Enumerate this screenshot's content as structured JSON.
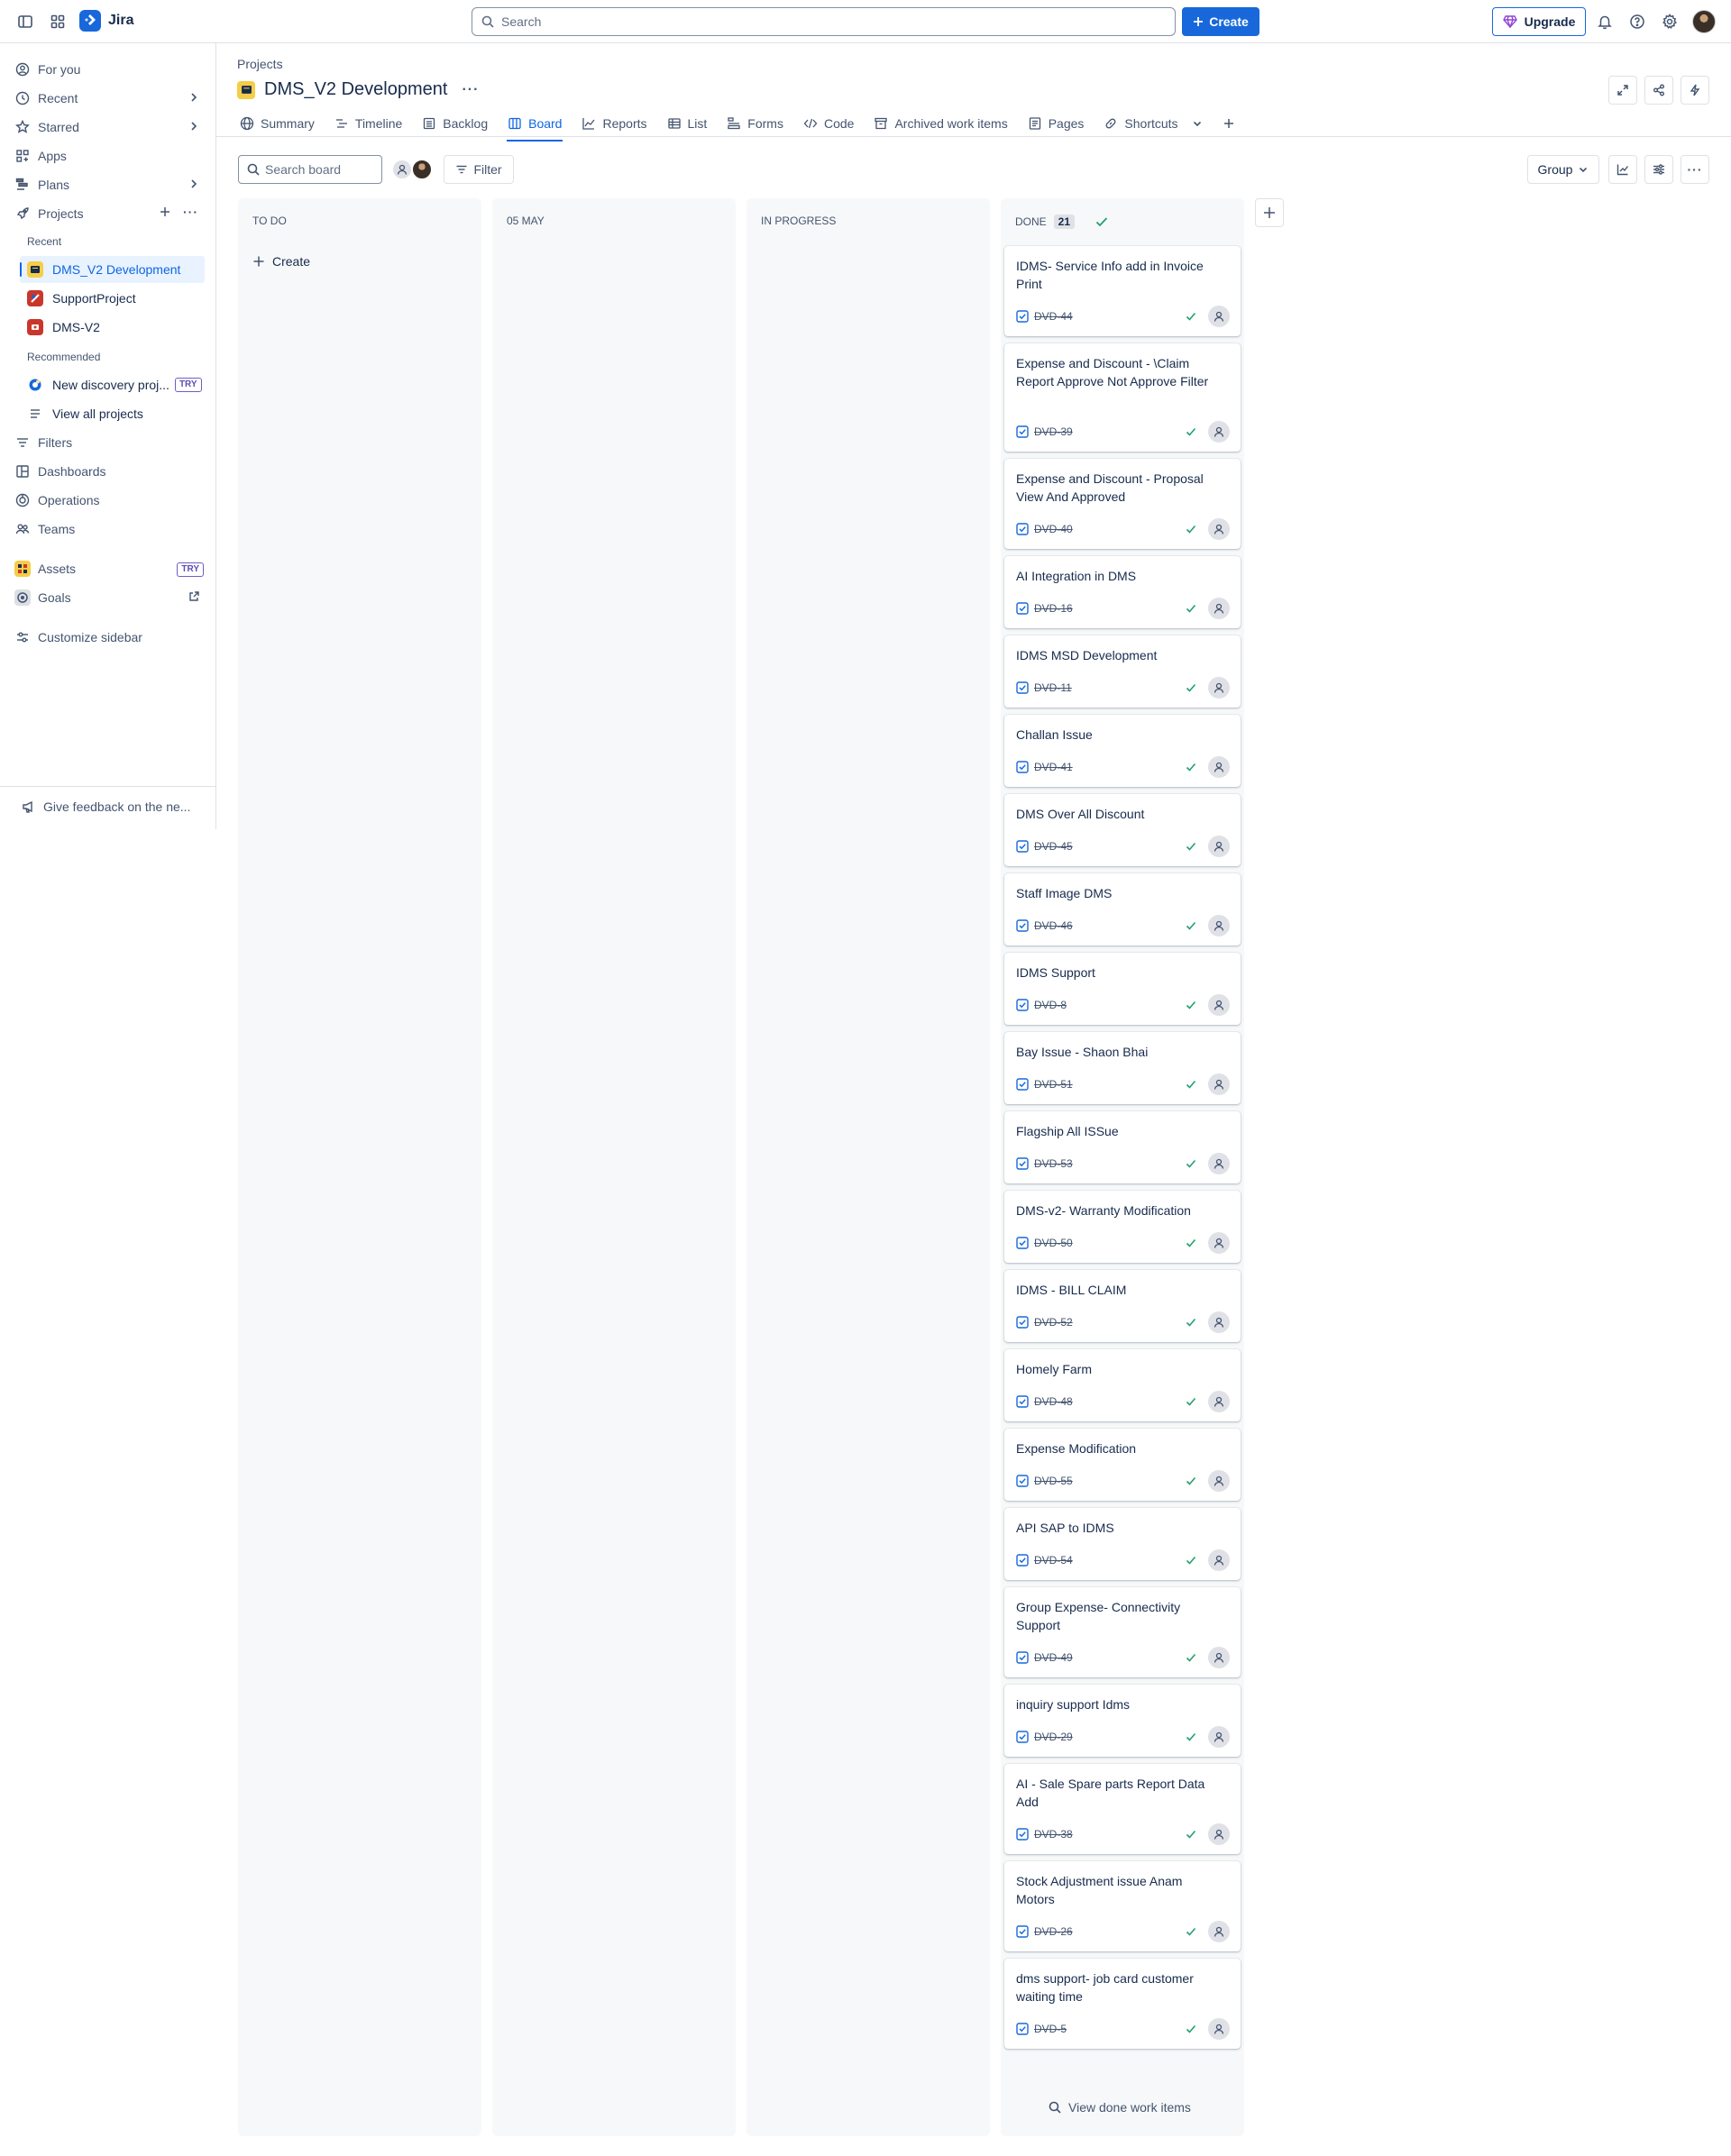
{
  "app": {
    "name": "Jira"
  },
  "topbar": {
    "search_placeholder": "Search",
    "create_label": "Create",
    "upgrade_label": "Upgrade"
  },
  "sidebar": {
    "nav": {
      "for_you": "For you",
      "recent": "Recent",
      "starred": "Starred",
      "apps": "Apps",
      "plans": "Plans",
      "projects": "Projects"
    },
    "recent_heading": "Recent",
    "recent_projects": [
      {
        "name": "DMS_V2 Development",
        "color": "#f5cd47"
      },
      {
        "name": "SupportProject",
        "color": "#c9372c"
      },
      {
        "name": "DMS-V2",
        "color": "#c9372c"
      }
    ],
    "recommended_heading": "Recommended",
    "new_discovery": "New discovery proj...",
    "try_badge": "TRY",
    "view_all_projects": "View all projects",
    "lower_nav": {
      "filters": "Filters",
      "dashboards": "Dashboards",
      "operations": "Operations",
      "teams": "Teams",
      "assets": "Assets",
      "goals": "Goals"
    },
    "customize": "Customize sidebar",
    "feedback": "Give feedback on the ne..."
  },
  "header": {
    "breadcrumb": "Projects",
    "project_title": "DMS_V2 Development",
    "more": "···"
  },
  "tabs": [
    {
      "label": "Summary",
      "icon": "globe-icon"
    },
    {
      "label": "Timeline",
      "icon": "timeline-icon"
    },
    {
      "label": "Backlog",
      "icon": "backlog-icon"
    },
    {
      "label": "Board",
      "icon": "board-icon",
      "active": true
    },
    {
      "label": "Reports",
      "icon": "reports-icon"
    },
    {
      "label": "List",
      "icon": "list-icon"
    },
    {
      "label": "Forms",
      "icon": "forms-icon"
    },
    {
      "label": "Code",
      "icon": "code-icon"
    },
    {
      "label": "Archived work items",
      "icon": "archive-icon"
    },
    {
      "label": "Pages",
      "icon": "pages-icon"
    },
    {
      "label": "Shortcuts",
      "icon": "link-icon"
    }
  ],
  "toolbar": {
    "search_placeholder": "Search board",
    "filter_label": "Filter",
    "group_label": "Group"
  },
  "columns": {
    "todo": "TO DO",
    "may": "05 MAY",
    "in_progress": "IN PROGRESS",
    "done": "DONE",
    "done_count": "21",
    "create_label": "Create"
  },
  "done_cards": [
    {
      "title": "IDMS- Service Info add in Invoice Print",
      "key": "DVD-44"
    },
    {
      "title": "Expense and Discount - \\Claim Report Approve Not Approve Filter",
      "key": "DVD-39"
    },
    {
      "title": "Expense and Discount - Proposal View And Approved",
      "key": "DVD-40"
    },
    {
      "title": "AI Integration in DMS",
      "key": "DVD-16"
    },
    {
      "title": "IDMS MSD Development",
      "key": "DVD-11"
    },
    {
      "title": "Challan Issue",
      "key": "DVD-41"
    },
    {
      "title": "DMS Over All Discount",
      "key": "DVD-45"
    },
    {
      "title": "Staff Image DMS",
      "key": "DVD-46"
    },
    {
      "title": "IDMS Support",
      "key": "DVD-8"
    },
    {
      "title": "Bay Issue - Shaon Bhai",
      "key": "DVD-51"
    },
    {
      "title": "Flagship All ISSue",
      "key": "DVD-53"
    },
    {
      "title": "DMS-v2- Warranty Modification",
      "key": "DVD-50"
    },
    {
      "title": "IDMS - BILL CLAIM",
      "key": "DVD-52"
    },
    {
      "title": "Homely Farm",
      "key": "DVD-48"
    },
    {
      "title": "Expense Modification",
      "key": "DVD-55"
    },
    {
      "title": "API SAP to IDMS",
      "key": "DVD-54"
    },
    {
      "title": "Group Expense- Connectivity Support",
      "key": "DVD-49"
    },
    {
      "title": "inquiry support Idms",
      "key": "DVD-29"
    },
    {
      "title": "AI - Sale Spare parts Report Data Add",
      "key": "DVD-38"
    },
    {
      "title": "Stock Adjustment issue Anam Motors",
      "key": "DVD-26"
    },
    {
      "title": "dms support- job card customer waiting time",
      "key": "DVD-5"
    }
  ],
  "view_done": "View done work items",
  "colors": {
    "brand": "#1868db",
    "accent": "#0c66e4",
    "done_green": "#22a06b",
    "column_bg": "#f7f8f9"
  }
}
